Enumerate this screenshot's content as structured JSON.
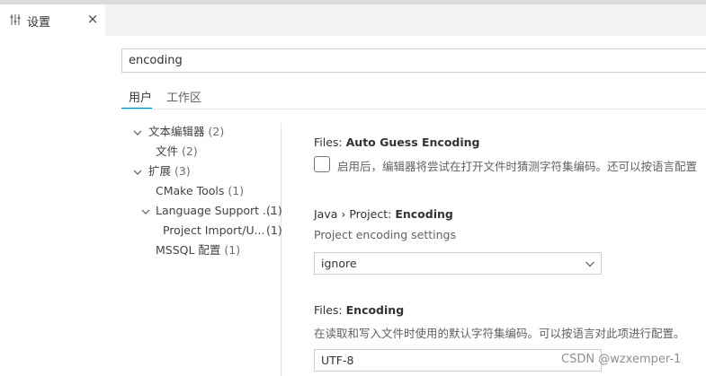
{
  "tab": {
    "title": "设置",
    "close_glyph": "×",
    "icon": "settings-sliders-icon"
  },
  "search": {
    "value": "encoding"
  },
  "scope_tabs": [
    {
      "label": "用户",
      "active": true
    },
    {
      "label": "工作区",
      "active": false
    }
  ],
  "toc": [
    {
      "label": "文本编辑器",
      "count": "(2)",
      "expanded": true
    },
    {
      "label": "文件",
      "count": "(2)"
    },
    {
      "label": "扩展",
      "count": "(3)",
      "expanded": true
    },
    {
      "label": "CMake Tools",
      "count": "(1)"
    },
    {
      "label": "Language Support ...",
      "count": "(1)",
      "expanded": true
    },
    {
      "label": "Project Import/U...",
      "count": "(1)"
    },
    {
      "label": "MSSQL 配置",
      "count": "(1)"
    }
  ],
  "settings": {
    "auto_guess": {
      "category": "Files: ",
      "name": "Auto Guess Encoding",
      "description": "启用后，编辑器将尝试在打开文件时猜测字符集编码。还可以按语言配置",
      "checked": false
    },
    "java_encoding": {
      "category": "Java › Project: ",
      "name": "Encoding",
      "description": "Project encoding settings",
      "value": "ignore"
    },
    "files_encoding": {
      "category": "Files: ",
      "name": "Encoding",
      "description": "在读取和写入文件时使用的默认字符集编码。可以按语言对此项进行配置。",
      "value": "UTF-8"
    }
  },
  "watermark": "CSDN @wzxemper-1",
  "colors": {
    "accent": "#007acc",
    "tabbar_bg": "#f3f3f3",
    "border": "#cecece"
  }
}
